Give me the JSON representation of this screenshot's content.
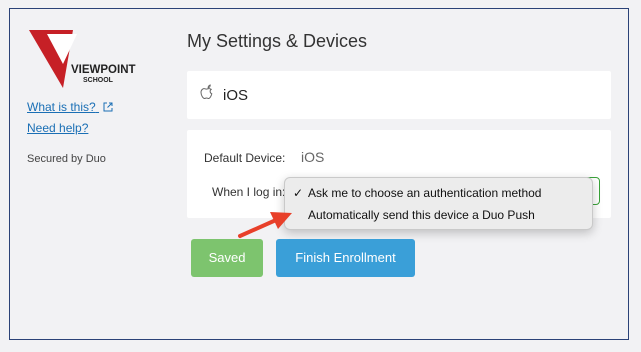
{
  "brand": {
    "logo_line1": "VIEWPOINT",
    "logo_line2": "SCHOOL",
    "logo_color": "#c62026"
  },
  "sidebar": {
    "what_is_this": "What is this?",
    "need_help": "Need help?",
    "secured_by": "Secured by Duo",
    "link_color": "#1a6fb5"
  },
  "main": {
    "title": "My Settings & Devices",
    "device": {
      "icon": "apple-icon",
      "name": "iOS"
    },
    "settings": {
      "default_device_label": "Default Device:",
      "default_device_value": "iOS",
      "login_label": "When I log in:",
      "login_select_border": "#3aa33a",
      "dropdown": {
        "options": [
          {
            "label": "Ask me to choose an authentication method",
            "checked": true
          },
          {
            "label": "Automatically send this device a Duo Push",
            "checked": false
          }
        ]
      }
    },
    "buttons": {
      "saved_label": "Saved",
      "saved_color": "#7dc46e",
      "finish_label": "Finish Enrollment",
      "finish_color": "#3a9fd8"
    }
  },
  "annotation": {
    "arrow_color": "#e8402a"
  }
}
